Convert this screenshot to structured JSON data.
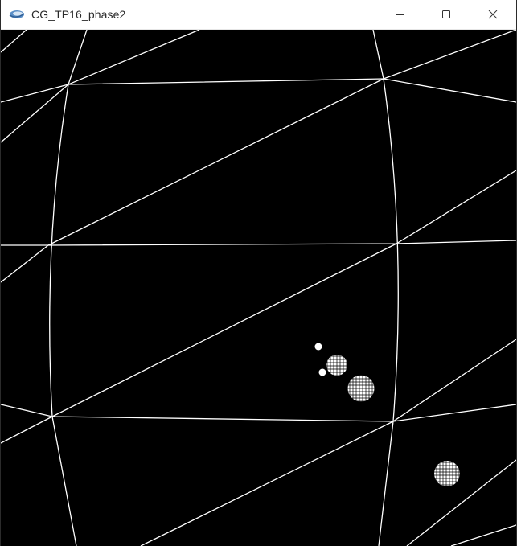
{
  "window": {
    "title": "CG_TP16_phase2",
    "app_icon": "opengl-app-icon",
    "controls": [
      "minimize-icon",
      "maximize-icon",
      "close-icon"
    ]
  },
  "scene": {
    "background_color": "#000000",
    "line_color": "#ffffff",
    "style": "wireframe"
  }
}
